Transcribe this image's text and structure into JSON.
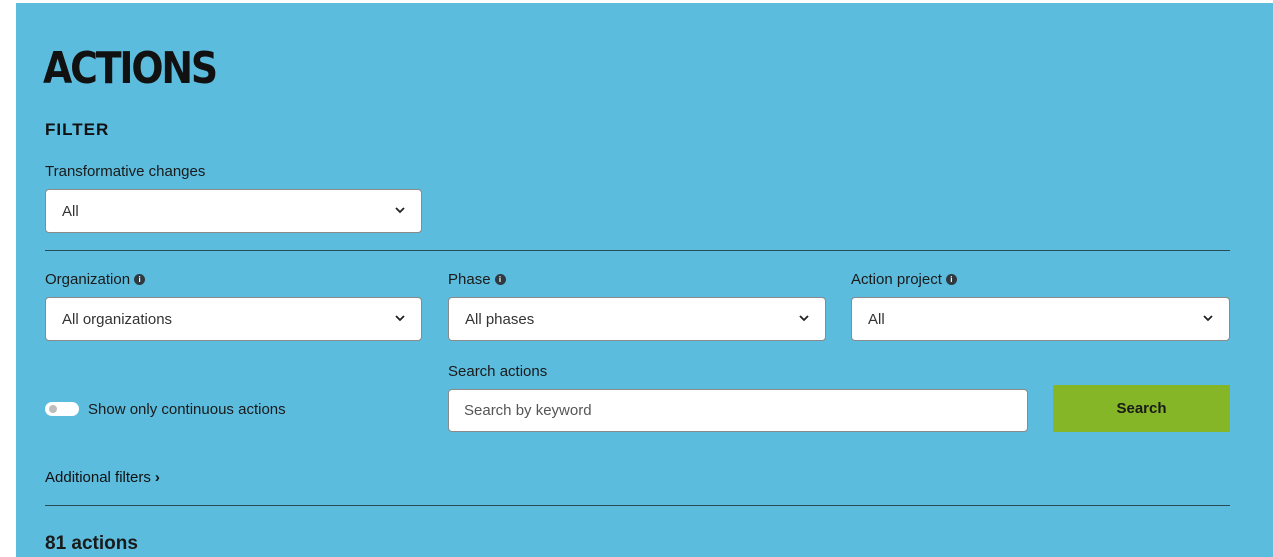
{
  "page": {
    "title": "ACTIONS",
    "filter_heading": "FILTER"
  },
  "filters": {
    "transformative_changes": {
      "label": "Transformative changes",
      "value": "All"
    },
    "organization": {
      "label": "Organization",
      "value": "All organizations"
    },
    "phase": {
      "label": "Phase",
      "value": "All phases"
    },
    "action_project": {
      "label": "Action project",
      "value": "All"
    },
    "continuous_toggle": {
      "label": "Show only continuous actions",
      "enabled": false
    },
    "search": {
      "label": "Search actions",
      "placeholder": "Search by keyword",
      "value": "",
      "button_label": "Search"
    },
    "additional_filters": {
      "label": "Additional filters",
      "arrow": "›"
    }
  },
  "results": {
    "count_text": "81 actions"
  },
  "colors": {
    "panel_background": "#5bbcdd",
    "search_button": "#84b627"
  },
  "icons": {
    "info": "info-icon",
    "dropdown": "chevron-down-icon"
  }
}
